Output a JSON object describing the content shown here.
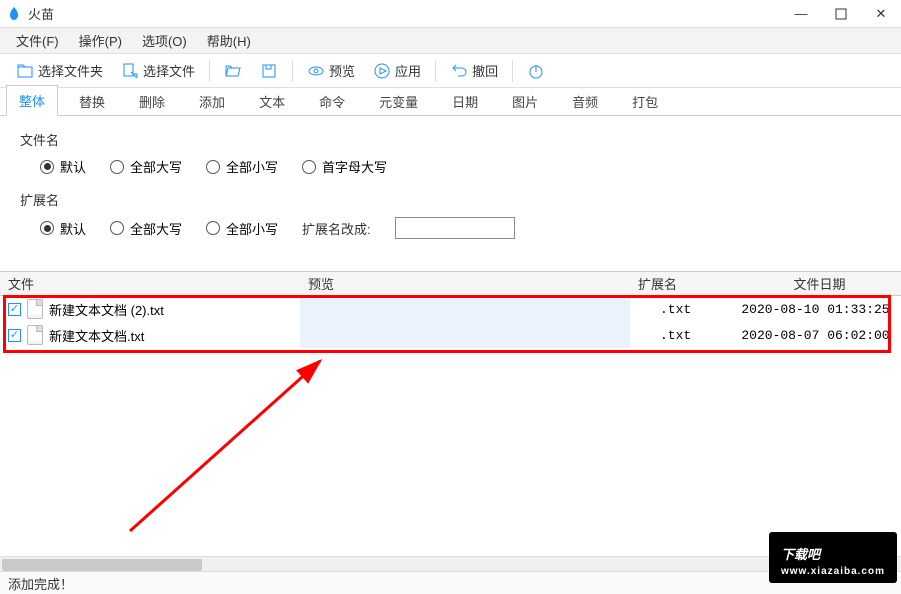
{
  "window": {
    "title": "火苗"
  },
  "menu": {
    "file": "文件(F)",
    "operate": "操作(P)",
    "option": "选项(O)",
    "help": "帮助(H)"
  },
  "toolbar": {
    "select_folder": "选择文件夹",
    "select_file": "选择文件",
    "preview": "预览",
    "apply": "应用",
    "undo": "撤回"
  },
  "tabs": {
    "items": [
      "整体",
      "替换",
      "删除",
      "添加",
      "文本",
      "命令",
      "元变量",
      "日期",
      "图片",
      "音频",
      "打包"
    ],
    "active": 0
  },
  "panel": {
    "filename_label": "文件名",
    "ext_label": "扩展名",
    "opt_default": "默认",
    "opt_upper": "全部大写",
    "opt_lower": "全部小写",
    "opt_camel": "首字母大写",
    "ext_change_label": "扩展名改成:",
    "ext_change_value": ""
  },
  "table": {
    "headers": {
      "file": "文件",
      "preview": "预览",
      "ext": "扩展名",
      "date": "文件日期"
    },
    "rows": [
      {
        "checked": true,
        "name": "新建文本文档 (2).txt",
        "ext": ".txt",
        "date": "2020-08-10 01:33:25"
      },
      {
        "checked": true,
        "name": "新建文本文档.txt",
        "ext": ".txt",
        "date": "2020-08-07 06:02:00"
      }
    ]
  },
  "status": {
    "text": "添加完成！"
  },
  "watermark": {
    "name": "下载吧",
    "url": "www.xiazaiba.com"
  }
}
